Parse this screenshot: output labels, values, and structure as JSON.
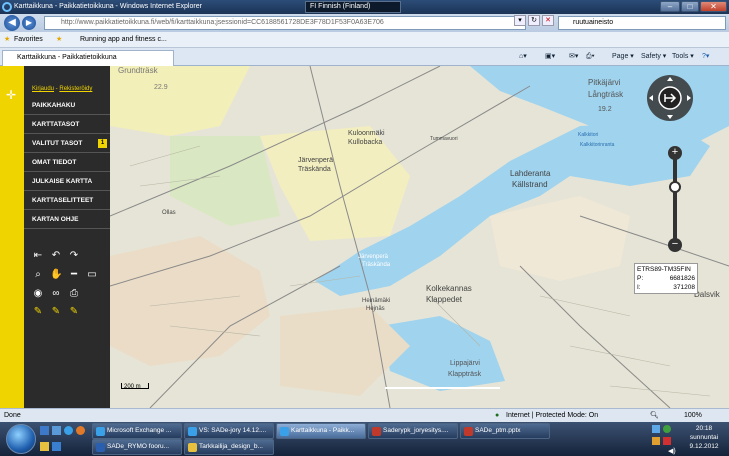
{
  "window": {
    "title": "Karttaikkuna - Paikkatietoikkuna - Windows Internet Explorer",
    "language_bar": "FI Finnish (Finland)"
  },
  "browser": {
    "address": "http://www.paikkatietoikkuna.fi/web/fi/karttaikkuna;jsessionid=CC6188561728DE3F78D1F53F0A63E706",
    "search_value": "ruutuaineisto",
    "favorites_label": "Favorites",
    "fav_item": "Running app and fitness c...",
    "tab_title": "Karttaikkuna - Paikkatietoikkuna",
    "cmd_page": "Page ▾",
    "cmd_safety": "Safety ▾",
    "cmd_tools": "Tools ▾"
  },
  "sidebar": {
    "login": "Kirjaudu",
    "separator": " - ",
    "register": "Rekisteröidy",
    "items": [
      {
        "label": "PAIKKAHAKU"
      },
      {
        "label": "KARTTATASOT"
      },
      {
        "label": "VALITUT TASOT",
        "badge": "1"
      },
      {
        "label": "OMAT TIEDOT"
      },
      {
        "label": "JULKAISE KARTTA"
      },
      {
        "label": "KARTTASELITTEET"
      },
      {
        "label": "KARTAN OHJE"
      }
    ],
    "accent_color": "#f0d400"
  },
  "map": {
    "labels": {
      "grundtrask": "Grundträsk",
      "elev1": "22.9",
      "pitkajarvi": "Pitkäjärvi",
      "langtrask": "Långträsk",
      "elev2": "19.2",
      "kuloonmaki": "Kuloonmäki",
      "kullobacka": "Kullobacka",
      "jarvenpera1": "Järvenperä",
      "traskanda1": "Träskända",
      "lahderanta": "Lahderanta",
      "kallstrand": "Källstrand",
      "kolkekannas": "Kolkekannas",
      "klappedet": "Klappedet",
      "jarvenpera2": "Järvenperä",
      "traskanda2": "Träskända",
      "lippajarvi": "Lippajärvi",
      "klapptrask": "Klappträsk",
      "dalsvik": "Dalsvik",
      "ollas": "Ollas",
      "heinamaki": "Heinämäki",
      "hejnas": "Hejnäs",
      "kalkkitori": "Kalkkitori",
      "tumma": "Tummavuori",
      "kalkkitorinranta": "Kalkkitorinranta"
    },
    "coords": {
      "system": "ETRS89-TM35FIN",
      "p_label": "P:",
      "p_value": "6681826",
      "i_label": "I:",
      "i_value": "371208"
    },
    "scale": "200 m"
  },
  "status": {
    "left": "Done",
    "zone": "Internet | Protected Mode: On",
    "zoom": "100%"
  },
  "taskbar": {
    "row1": [
      "Microsoft Exchange ...",
      "VS: SADe-jory 14.12....",
      "Karttaikkuna - Paikk...",
      "Saderypk_joryesitys....",
      "SADe_ptm.pptx"
    ],
    "row2": [
      "SADe_RYMO fooru...",
      "Tarkkailija_design_b..."
    ],
    "clock_time": "20:18",
    "clock_day": "sunnuntai",
    "clock_date": "9.12.2012"
  }
}
